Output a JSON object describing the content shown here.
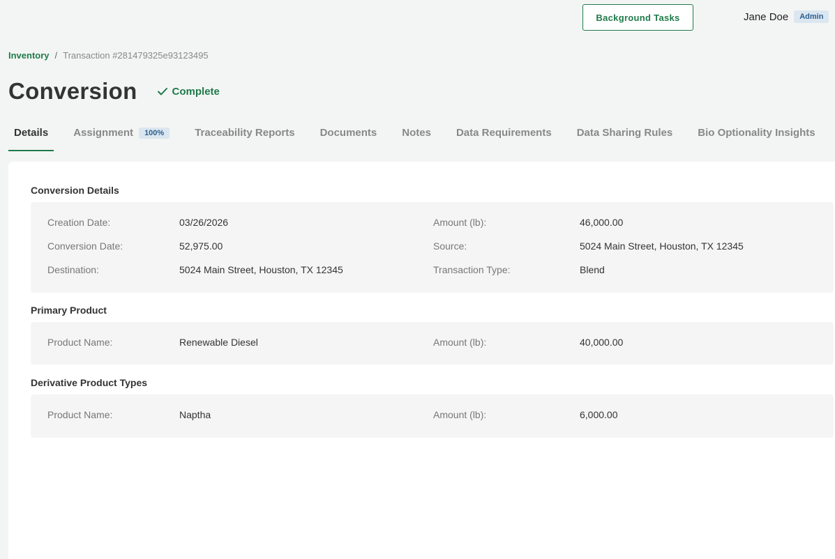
{
  "header": {
    "background_tasks_label": "Background Tasks",
    "user_name": "Jane Doe",
    "user_role": "Admin"
  },
  "breadcrumb": {
    "root": "Inventory",
    "separator": "/",
    "current": "Transaction #281479325e93123495"
  },
  "page": {
    "title": "Conversion",
    "status": "Complete"
  },
  "tabs": [
    {
      "label": "Details",
      "active": true
    },
    {
      "label": "Assignment",
      "badge": "100%"
    },
    {
      "label": "Traceability Reports"
    },
    {
      "label": "Documents"
    },
    {
      "label": "Notes"
    },
    {
      "label": "Data Requirements"
    },
    {
      "label": "Data Sharing Rules"
    },
    {
      "label": "Bio Optionality Insights"
    }
  ],
  "conversion_details": {
    "title": "Conversion Details",
    "creation_date_label": "Creation Date:",
    "creation_date": "03/26/2026",
    "amount_label": "Amount (lb):",
    "amount": "46,000.00",
    "conversion_date_label": "Conversion Date:",
    "conversion_date": "52,975.00",
    "source_label": "Source:",
    "source": "5024 Main Street, Houston, TX 12345",
    "destination_label": "Destination:",
    "destination": "5024 Main Street, Houston, TX 12345",
    "transaction_type_label": "Transaction Type:",
    "transaction_type": "Blend"
  },
  "primary_product": {
    "title": "Primary Product",
    "product_name_label": "Product Name:",
    "product_name": "Renewable Diesel",
    "amount_label": "Amount (lb):",
    "amount": "40,000.00"
  },
  "derivative_products": {
    "title": "Derivative Product Types",
    "product_name_label": "Product Name:",
    "product_name": "Naptha",
    "amount_label": "Amount (lb):",
    "amount": "6,000.00"
  },
  "colors": {
    "accent": "#1f7a4a",
    "badge_bg": "#dbe6f0",
    "badge_text": "#2c5f8e"
  }
}
